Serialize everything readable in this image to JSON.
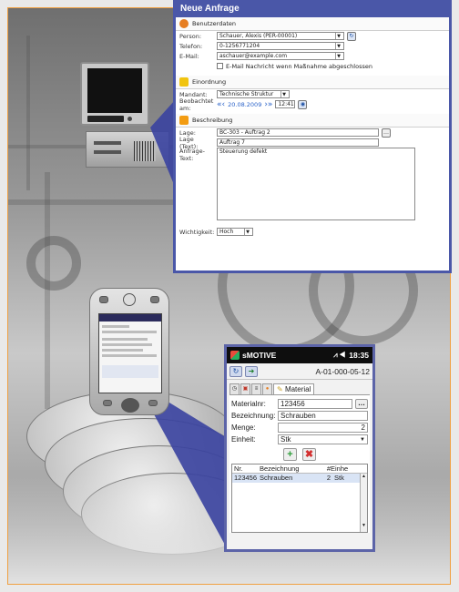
{
  "desktop": {
    "title": "Neue Anfrage",
    "requester_section": "Benutzerdaten",
    "person_label": "Person:",
    "person_value": "Schauer, Alexis (PER-00001)",
    "phone_label": "Telefon:",
    "phone_value": "0-1256771204",
    "email_label": "E-Mail:",
    "email_value": "aschauer@example.com",
    "email_notify_label": "E-Mail Nachricht wenn Maßnahme abgeschlossen",
    "entry_section": "Einordnung",
    "client_label": "Mandant:",
    "client_value": "Technische Struktur",
    "date_label": "Beobachtet am:",
    "date_value": "20.08.2009",
    "time_value": "12:41",
    "description_section": "Beschreibung",
    "location_label": "Lage:",
    "location_value": "BC-303 - Auftrag 2",
    "location_text_label": "Lage (Text):",
    "location_text_value": "Auftrag 7",
    "request_text_label": "Anfrage-Text:",
    "request_text_value": "Steuerung defekt",
    "priority_label": "Wichtigkeit:",
    "priority_value": "Hoch"
  },
  "mobile": {
    "app_name": "sMOTIVE",
    "time": "18:35",
    "record_id": "A-01-000-05-12",
    "active_tab": "Material",
    "material_nr_label": "Materialnr:",
    "material_nr_value": "123456",
    "description_label": "Bezeichnung:",
    "description_value": "Schrauben",
    "quantity_label": "Menge:",
    "quantity_value": "2",
    "unit_label": "Einheit:",
    "unit_value": "Stk",
    "table_headers": [
      "Nr.",
      "Bezeichnung",
      "#",
      "Einhe"
    ],
    "table_rows": [
      {
        "nr": "123456",
        "bez": "Schrauben",
        "menge": "2",
        "einheit": "Stk"
      }
    ]
  },
  "pda_screen": {
    "app_name": "sMOTIVE",
    "record_id": "A-01-000-05-12"
  },
  "colors": {
    "callout": "#3a43a0",
    "frame_border": "#f0a040",
    "window_border": "#4a57a8"
  }
}
